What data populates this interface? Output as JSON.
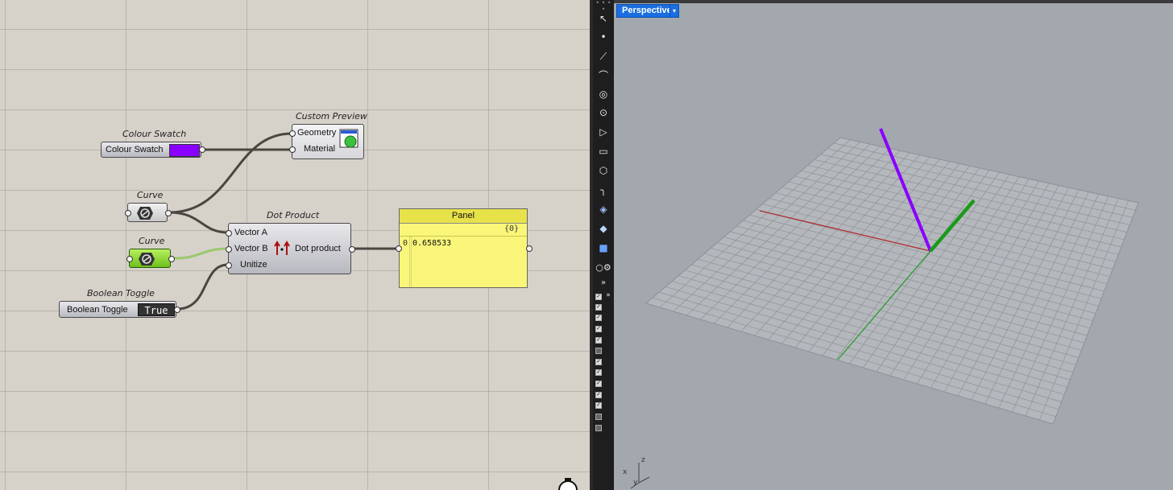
{
  "canvas": {
    "colour_swatch": {
      "caption": "Colour Swatch",
      "label": "Colour Swatch",
      "color": "#8a00ff"
    },
    "custom_preview": {
      "caption": "Custom Preview",
      "inputs": [
        "Geometry",
        "Material"
      ]
    },
    "curve1": {
      "caption": "Curve"
    },
    "curve2": {
      "caption": "Curve"
    },
    "dot_product": {
      "caption": "Dot Product",
      "inputs": [
        "Vector A",
        "Vector B",
        "Unitize"
      ],
      "output": "Dot product"
    },
    "boolean_toggle": {
      "caption": "Boolean Toggle",
      "label": "Boolean Toggle",
      "value": "True"
    },
    "panel": {
      "title": "Panel",
      "path": "{0}",
      "index": "0",
      "value": "0.658533"
    }
  },
  "viewport": {
    "name": "Perspective",
    "axis_labels": {
      "x": "x",
      "y": "y",
      "z": "z"
    },
    "colors": {
      "background": "#a3a8ae",
      "x_axis": "#b03030",
      "y_axis": "#2a9a2a",
      "vector_a": "#8a00ff",
      "vector_b": "#1a9a1a"
    }
  },
  "toolbar": {
    "icons": [
      "select-arrow-icon",
      "point-icon",
      "polyline-icon",
      "curve-icon",
      "circle-icon",
      "ellipse-icon",
      "arc-icon",
      "rectangle-icon",
      "polygon-icon",
      "fillet-icon",
      "transform-icon",
      "edit-icon",
      "box-icon",
      "settings-icon",
      "expand-icon"
    ]
  }
}
